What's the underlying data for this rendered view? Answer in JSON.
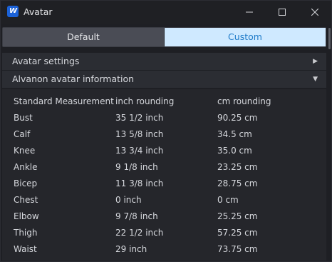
{
  "window": {
    "logo_text": "W",
    "title": "Avatar"
  },
  "tabs": [
    {
      "label": "Default",
      "selected": false
    },
    {
      "label": "Custom",
      "selected": true
    }
  ],
  "sections": {
    "settings": {
      "label": "Avatar settings",
      "arrow": "▶",
      "expanded": false
    },
    "alvanon": {
      "label": "Alvanon avatar information",
      "arrow": "▼",
      "expanded": true
    }
  },
  "table": {
    "headers": [
      "Standard Measurement",
      "inch rounding",
      "cm rounding"
    ],
    "rows": [
      [
        "Bust",
        "35 1/2 inch",
        "90.25 cm"
      ],
      [
        "Calf",
        "13 5/8 inch",
        "34.5 cm"
      ],
      [
        "Knee",
        "13 3/4 inch",
        "35.0 cm"
      ],
      [
        "Ankle",
        "9 1/8 inch",
        "23.25 cm"
      ],
      [
        "Bicep",
        "11 3/8 inch",
        "28.75 cm"
      ],
      [
        "Chest",
        "0 inch",
        "0 cm"
      ],
      [
        "Elbow",
        "9 7/8 inch",
        "25.25 cm"
      ],
      [
        "Thigh",
        "22 1/2 inch",
        "57.25 cm"
      ],
      [
        "Waist",
        "29 inch",
        "73.75 cm"
      ]
    ]
  },
  "colors": {
    "accent_selected_tab_bg": "#cfe9ff",
    "accent_selected_tab_text": "#1f7bc9",
    "logo_bg": "#1b62d8",
    "window_bg": "#1e1f24",
    "section_bg": "#2b2d33"
  },
  "icons": {
    "minimize": "minimize-icon",
    "maximize": "maximize-icon",
    "close": "close-icon",
    "collapsed": "triangle-right-icon",
    "expanded": "triangle-down-icon"
  }
}
